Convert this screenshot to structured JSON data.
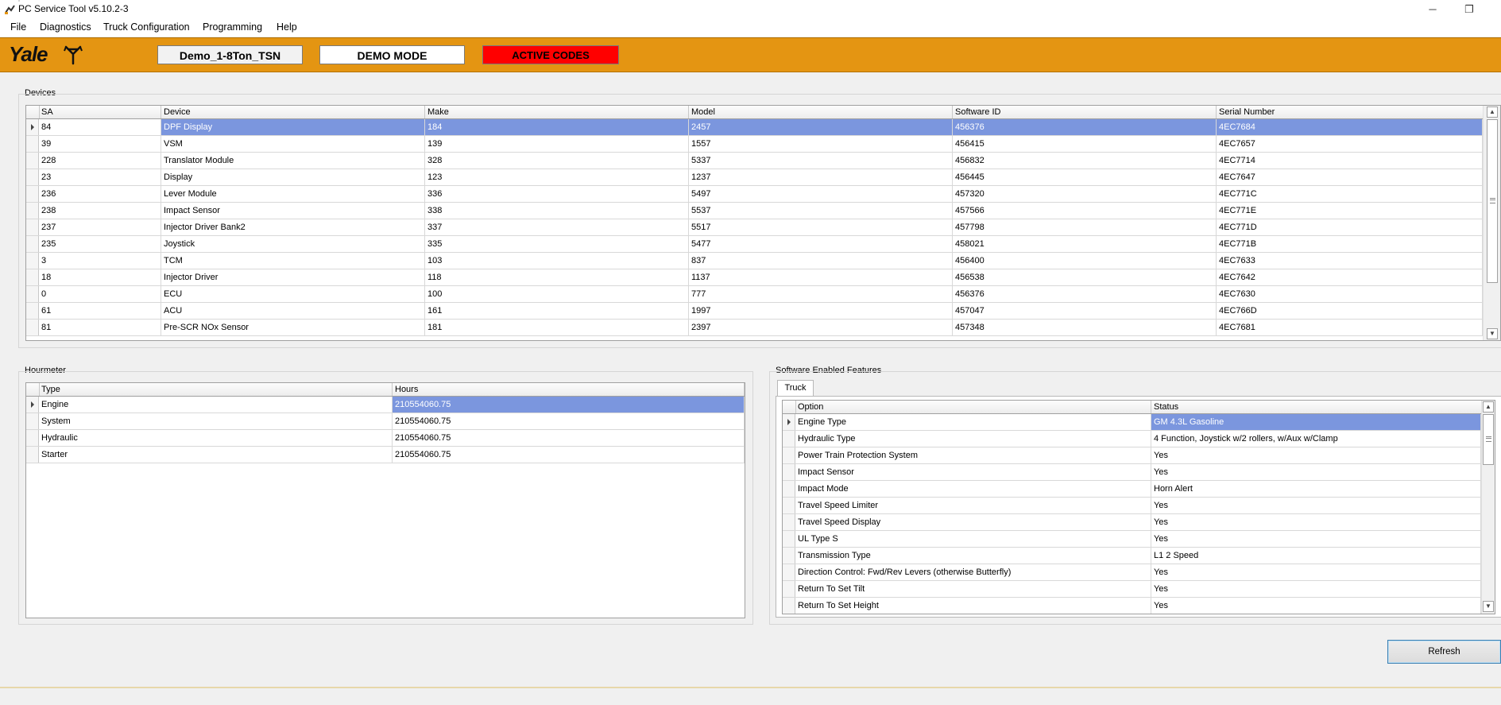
{
  "window": {
    "title": "PC Service Tool v5.10.2-3",
    "minimize": "─",
    "restore": "❐"
  },
  "menu": [
    "File",
    "Diagnostics",
    "Truck Configuration",
    "Programming",
    "Help"
  ],
  "header": {
    "logo": "Yale",
    "truck_name": "Demo_1-8Ton_TSN",
    "mode": "DEMO MODE",
    "active_codes": "ACTIVE CODES",
    "colors": {
      "bar": "#e49512",
      "active_codes": "#ff0000"
    }
  },
  "devices": {
    "label": "Devices",
    "columns": [
      "SA",
      "Device",
      "Make",
      "Model",
      "Software ID",
      "Serial Number"
    ],
    "rows": [
      [
        "84",
        "DPF Display",
        "184",
        "2457",
        "456376",
        "4EC7684"
      ],
      [
        "39",
        "VSM",
        "139",
        "1557",
        "456415",
        "4EC7657"
      ],
      [
        "228",
        "Translator Module",
        "328",
        "5337",
        "456832",
        "4EC7714"
      ],
      [
        "23",
        "Display",
        "123",
        "1237",
        "456445",
        "4EC7647"
      ],
      [
        "236",
        "Lever Module",
        "336",
        "5497",
        "457320",
        "4EC771C"
      ],
      [
        "238",
        "Impact Sensor",
        "338",
        "5537",
        "457566",
        "4EC771E"
      ],
      [
        "237",
        "Injector Driver Bank2",
        "337",
        "5517",
        "457798",
        "4EC771D"
      ],
      [
        "235",
        "Joystick",
        "335",
        "5477",
        "458021",
        "4EC771B"
      ],
      [
        "3",
        "TCM",
        "103",
        "837",
        "456400",
        "4EC7633"
      ],
      [
        "18",
        "Injector Driver",
        "118",
        "1137",
        "456538",
        "4EC7642"
      ],
      [
        "0",
        "ECU",
        "100",
        "777",
        "456376",
        "4EC7630"
      ],
      [
        "61",
        "ACU",
        "161",
        "1997",
        "457047",
        "4EC766D"
      ],
      [
        "81",
        "Pre-SCR NOx Sensor",
        "181",
        "2397",
        "457348",
        "4EC7681"
      ]
    ]
  },
  "hourmeter": {
    "label": "Hourmeter",
    "columns": [
      "Type",
      "Hours"
    ],
    "rows": [
      [
        "Engine",
        "210554060.75"
      ],
      [
        "System",
        "210554060.75"
      ],
      [
        "Hydraulic",
        "210554060.75"
      ],
      [
        "Starter",
        "210554060.75"
      ]
    ]
  },
  "features": {
    "label": "Software Enabled Features",
    "tab": "Truck",
    "columns": [
      "Option",
      "Status"
    ],
    "rows": [
      [
        "Engine Type",
        "GM 4.3L Gasoline"
      ],
      [
        "Hydraulic Type",
        "4 Function, Joystick w/2 rollers, w/Aux w/Clamp"
      ],
      [
        "Power Train Protection System",
        "Yes"
      ],
      [
        "Impact Sensor",
        "Yes"
      ],
      [
        "Impact Mode",
        "Horn Alert"
      ],
      [
        "Travel Speed Limiter",
        "Yes"
      ],
      [
        "Travel Speed Display",
        "Yes"
      ],
      [
        "UL Type S",
        "Yes"
      ],
      [
        "Transmission Type",
        "L1 2 Speed"
      ],
      [
        "Direction Control: Fwd/Rev Levers (otherwise Butterfly)",
        "Yes"
      ],
      [
        "Return To Set Tilt",
        "Yes"
      ],
      [
        "Return To Set Height",
        "Yes"
      ]
    ]
  },
  "refresh_label": "Refresh",
  "selection_color": "#7b96de"
}
